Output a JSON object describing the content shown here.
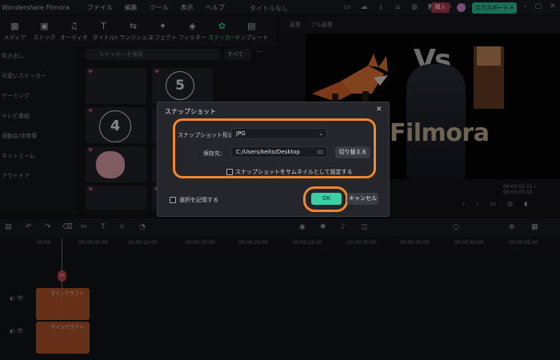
{
  "app": {
    "title": "Wondershare Filmora",
    "document_title": "タイトルなし",
    "menu": [
      "ファイル",
      "編集",
      "ツール",
      "表示",
      "ヘルプ"
    ],
    "purchase_label": "購入",
    "export_label": "エクスポート ▾"
  },
  "tools": [
    {
      "label": "メディア",
      "icon": "folder-icon"
    },
    {
      "label": "ストック",
      "icon": "stock-icon"
    },
    {
      "label": "オーディオ",
      "icon": "music-icon"
    },
    {
      "label": "タイトル",
      "icon": "text-icon"
    },
    {
      "label": "トランジション",
      "icon": "transition-icon"
    },
    {
      "label": "エフェクト",
      "icon": "effect-icon"
    },
    {
      "label": "フィルター",
      "icon": "filter-icon"
    },
    {
      "label": "ステッカー",
      "icon": "sticker-icon"
    },
    {
      "label": "テンプレート",
      "icon": "template-icon"
    }
  ],
  "sidebar": {
    "items": [
      "吹き出し",
      "可愛いステッカー",
      "ゲーミング",
      "テレビ番組",
      "運動会/体育祭",
      "ネットミーム",
      "アウトドア"
    ]
  },
  "stickers": {
    "search_placeholder": "ステッカーを検索",
    "filter_label": "すべて",
    "number_five": "5",
    "number_four": "4"
  },
  "preview": {
    "quality_label": "画質",
    "fit_label": "フル画質",
    "vs_text": "Vs",
    "brand_text": "Filmora",
    "timecode": "00:00:02:11  /  00:00:03:10"
  },
  "timeline": {
    "ruler": [
      "00:00",
      "00:00:05:00",
      "00:00:10:00",
      "00:00:15:00",
      "00:00:20:00",
      "00:00:25:00",
      "00:00:30:00",
      "00:00:35:00",
      "00:00:40:00",
      "00:00:45:00"
    ],
    "clip1_label": "マインクラフト",
    "clip2_label": "マインクラフト"
  },
  "dialog": {
    "title": "スナップショット",
    "format_label": "スナップショット形式：",
    "format_value": "JPG",
    "save_label": "保存先：",
    "save_path": "C:/Users/keito/Desktop",
    "switch_button": "切り替える",
    "thumbnail_checkbox": "スナップショットをサムネイルとして設定する",
    "remember_checkbox": "選択を記憶する",
    "ok_button": "OK",
    "cancel_button": "キャンセル"
  },
  "colors": {
    "accent": "#3ad0a3",
    "highlight": "#f0872f",
    "purchase": "#b83a4b"
  }
}
